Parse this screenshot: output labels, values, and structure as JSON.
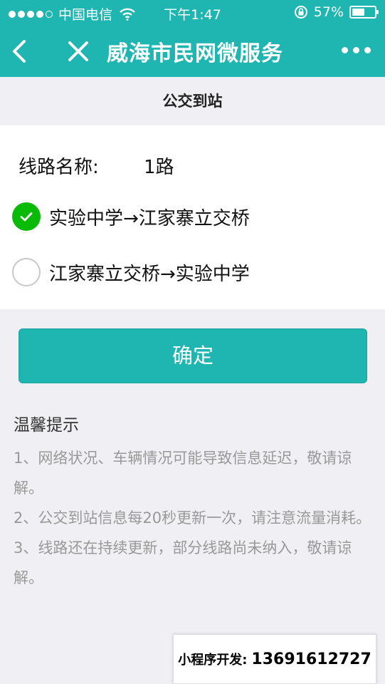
{
  "status": {
    "carrier": "中国电信",
    "time": "下午1:47",
    "battery": "57%",
    "battery_level": 0.57
  },
  "nav": {
    "title": "威海市民网微服务"
  },
  "page": {
    "title": "公交到站"
  },
  "route": {
    "label": "线路名称:",
    "value": "1路"
  },
  "options": [
    {
      "label": "实验中学→江家寨立交桥",
      "checked": true
    },
    {
      "label": "江家寨立交桥→实验中学",
      "checked": false
    }
  ],
  "confirm_label": "确定",
  "tips": {
    "title": "温馨提示",
    "items": [
      "1、网络状况、车辆情况可能导致信息延迟，敬请谅解。",
      "2、公交到站信息每20秒更新一次，请注意流量消耗。",
      "3、线路还在持续更新，部分线路尚未纳入，敬请谅解。"
    ]
  },
  "developer": {
    "label": "小程序开发:",
    "phone": "13691612727"
  },
  "colors": {
    "primary": "#1fb5b1",
    "check": "#09bb07"
  }
}
